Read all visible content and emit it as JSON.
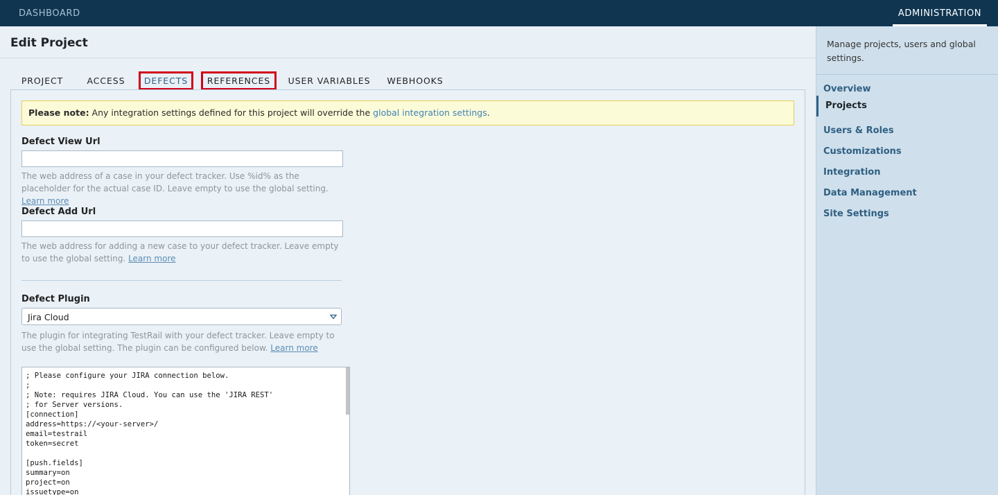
{
  "topbar": {
    "dashboard_label": "DASHBOARD",
    "administration_label": "ADMINISTRATION"
  },
  "page": {
    "title": "Edit Project"
  },
  "tabs": [
    {
      "label": "PROJECT"
    },
    {
      "label": "ACCESS"
    },
    {
      "label": "DEFECTS"
    },
    {
      "label": "REFERENCES"
    },
    {
      "label": "USER VARIABLES"
    },
    {
      "label": "WEBHOOKS"
    }
  ],
  "note": {
    "prefix": "Please note:",
    "text": " Any integration settings defined for this project will override the ",
    "link": "global integration settings",
    "suffix": "."
  },
  "defect_view_url": {
    "label": "Defect View Url",
    "value": "",
    "help": "The web address of a case in your defect tracker. Use %id% as the placeholder for the actual case ID. Leave empty to use the global setting. ",
    "learn_more": "Learn more"
  },
  "defect_add_url": {
    "label": "Defect Add Url",
    "value": "",
    "help": "The web address for adding a new case to your defect tracker. Leave empty to use the global setting. ",
    "learn_more": "Learn more"
  },
  "defect_plugin": {
    "label": "Defect Plugin",
    "selected": "Jira Cloud",
    "help": "The plugin for integrating TestRail with your defect tracker. Leave empty to use the global setting. The plugin can be configured below. ",
    "learn_more": "Learn more"
  },
  "config_text": "; Please configure your JIRA connection below.\n;\n; Note: requires JIRA Cloud. You can use the 'JIRA REST'\n; for Server versions.\n[connection]\naddress=https://<your-server>/\nemail=testrail\ntoken=secret\n\n[push.fields]\nsummary=on\nproject=on\nissuetype=on",
  "sidebar": {
    "description": "Manage projects, users and global settings.",
    "items": [
      {
        "label": "Overview"
      },
      {
        "label": "Projects"
      },
      {
        "label": "Users & Roles"
      },
      {
        "label": "Customizations"
      },
      {
        "label": "Integration"
      },
      {
        "label": "Data Management"
      },
      {
        "label": "Site Settings"
      }
    ]
  },
  "colors": {
    "topbar": "#0f3550",
    "accent": "#2f5f82",
    "highlight_box": "#d0021b",
    "note_bg": "#fcfbd8"
  }
}
